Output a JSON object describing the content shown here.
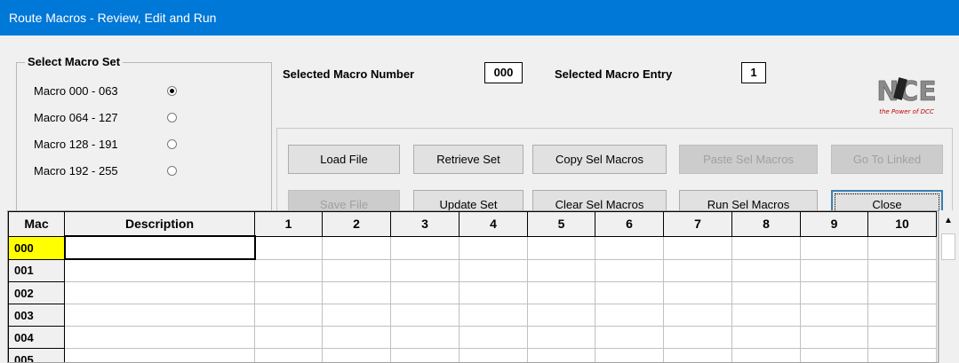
{
  "window": {
    "title": "Route Macros - Review, Edit and Run"
  },
  "macro_set": {
    "title": "Select Macro Set",
    "options": [
      {
        "label": "Macro  000 - 063",
        "checked": true
      },
      {
        "label": "Macro  064 - 127",
        "checked": false
      },
      {
        "label": "Macro  128 - 191",
        "checked": false
      },
      {
        "label": "Macro  192 - 255",
        "checked": false
      }
    ]
  },
  "selected": {
    "number_label": "Selected Macro Number",
    "number_value": "000",
    "entry_label": "Selected Macro Entry",
    "entry_value": "1"
  },
  "logo": {
    "text": "NCE",
    "tagline": "the Power of DCC"
  },
  "buttons": {
    "load_file": "Load File",
    "retrieve_set": "Retrieve Set",
    "copy_sel_macros": "Copy Sel Macros",
    "paste_sel_macros": "Paste Sel Macros",
    "go_to_linked": "Go To Linked",
    "save_file": "Save File",
    "update_set": "Update Set",
    "clear_sel_macros": "Clear Sel Macros",
    "run_sel_macros": "Run Sel Macros",
    "close": "Close"
  },
  "grid": {
    "headers": [
      "Mac",
      "Description",
      "1",
      "2",
      "3",
      "4",
      "5",
      "6",
      "7",
      "8",
      "9",
      "10"
    ],
    "rows": [
      "000",
      "001",
      "002",
      "003",
      "004",
      "005"
    ],
    "current_row": "000"
  },
  "colors": {
    "titlebar": "#0078d7",
    "current_row": "#ffff00"
  }
}
